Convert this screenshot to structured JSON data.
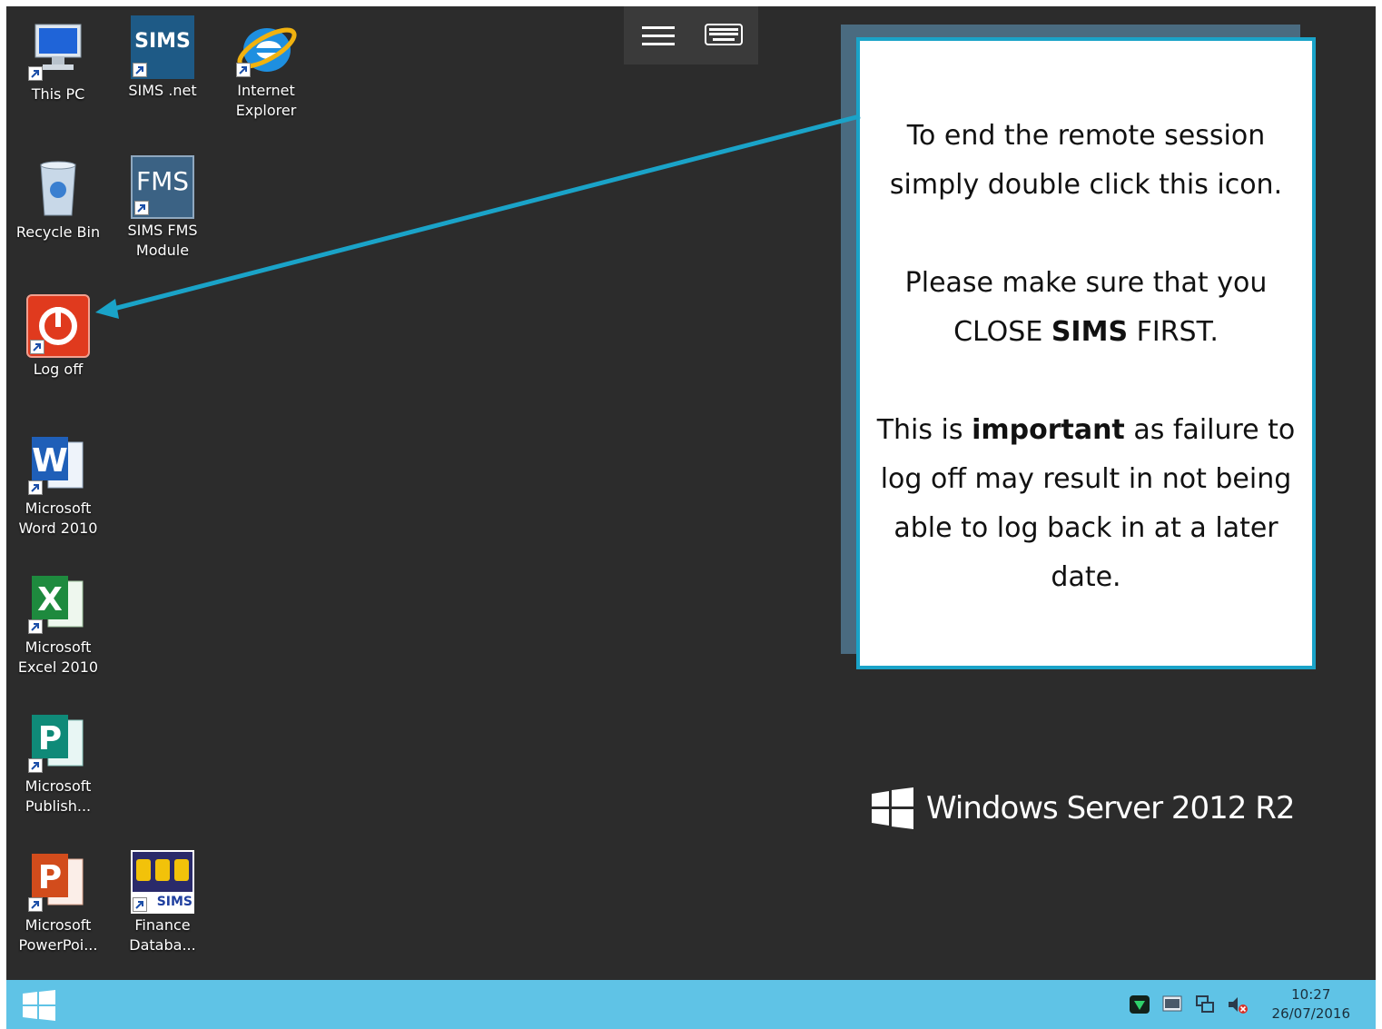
{
  "desktop": {
    "background_color": "#2c2c2c",
    "icons": [
      {
        "id": "this-pc",
        "label": "This PC"
      },
      {
        "id": "sims-net",
        "label": "SIMS .net",
        "image_text": "SIMS"
      },
      {
        "id": "internet-explorer",
        "label": "Internet\nExplorer"
      },
      {
        "id": "recycle-bin",
        "label": "Recycle Bin"
      },
      {
        "id": "sims-fms",
        "label": "SIMS FMS\nModule",
        "image_text": "FMS"
      },
      {
        "id": "log-off",
        "label": "Log off"
      },
      {
        "id": "word",
        "label": "Microsoft\nWord 2010"
      },
      {
        "id": "excel",
        "label": "Microsoft\nExcel 2010"
      },
      {
        "id": "publisher",
        "label": "Microsoft\nPublish..."
      },
      {
        "id": "powerpoint",
        "label": "Microsoft\nPowerPoi..."
      },
      {
        "id": "finance-db",
        "label": "Finance\nDataba...",
        "image_text": "SIMS"
      }
    ]
  },
  "remote_toolbar": {
    "icons": [
      "menu-icon",
      "keyboard-icon"
    ]
  },
  "callout": {
    "paragraph1": "To end the remote session simply double click this icon.",
    "paragraph2": {
      "before": "Please make sure that you CLOSE ",
      "bold": "SIMS",
      "after": " FIRST."
    },
    "paragraph3": {
      "before": "This is ",
      "bold": "important",
      "after": " as failure to log off may result in not being able to log back in at a later date."
    },
    "border_color": "#1aa3c8"
  },
  "branding": {
    "text": "Windows Server 2012 R2"
  },
  "taskbar": {
    "color": "#5fc3e6",
    "tray_icons": [
      "security-shield-icon",
      "vmware-icon",
      "network-icon",
      "volume-muted-icon"
    ],
    "time": "10:27",
    "date": "26/07/2016"
  }
}
